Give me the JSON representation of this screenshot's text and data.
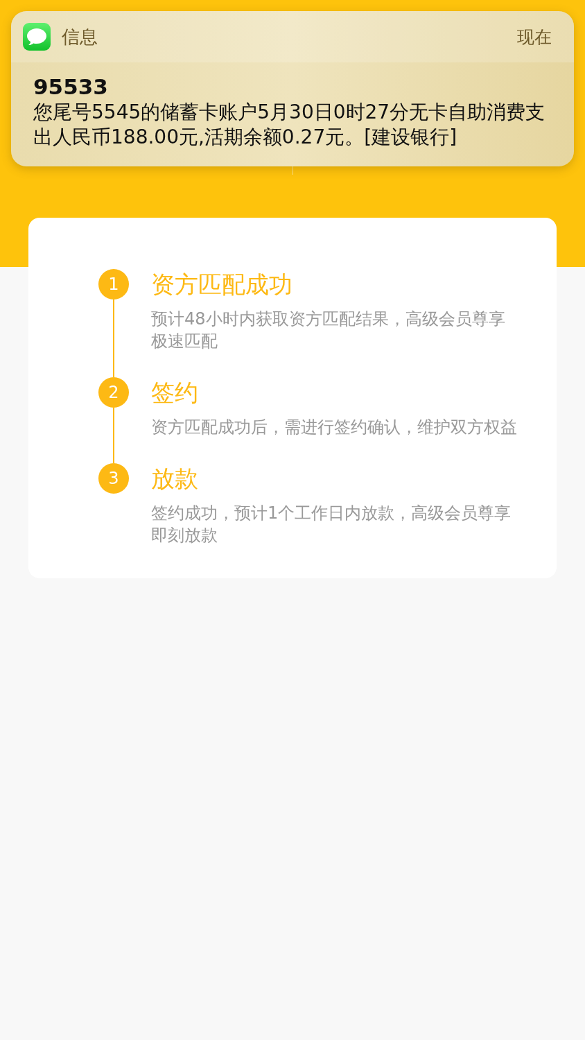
{
  "notification": {
    "app": "信息",
    "time": "现在",
    "sender": "95533",
    "message": "您尾号5545的储蓄卡账户5月30日0时27分无卡自助消费支出人民币188.00元,活期余额0.27元。[建设银行]"
  },
  "steps": [
    {
      "number": "1",
      "title": "资方匹配成功",
      "description": "预计48小时内获取资方匹配结果，高级会员尊享极速匹配"
    },
    {
      "number": "2",
      "title": "签约",
      "description": "资方匹配成功后，需进行签约确认，维护双方权益"
    },
    {
      "number": "3",
      "title": "放款",
      "description": "签约成功，预计1个工作日内放款，高级会员尊享即刻放款"
    }
  ]
}
